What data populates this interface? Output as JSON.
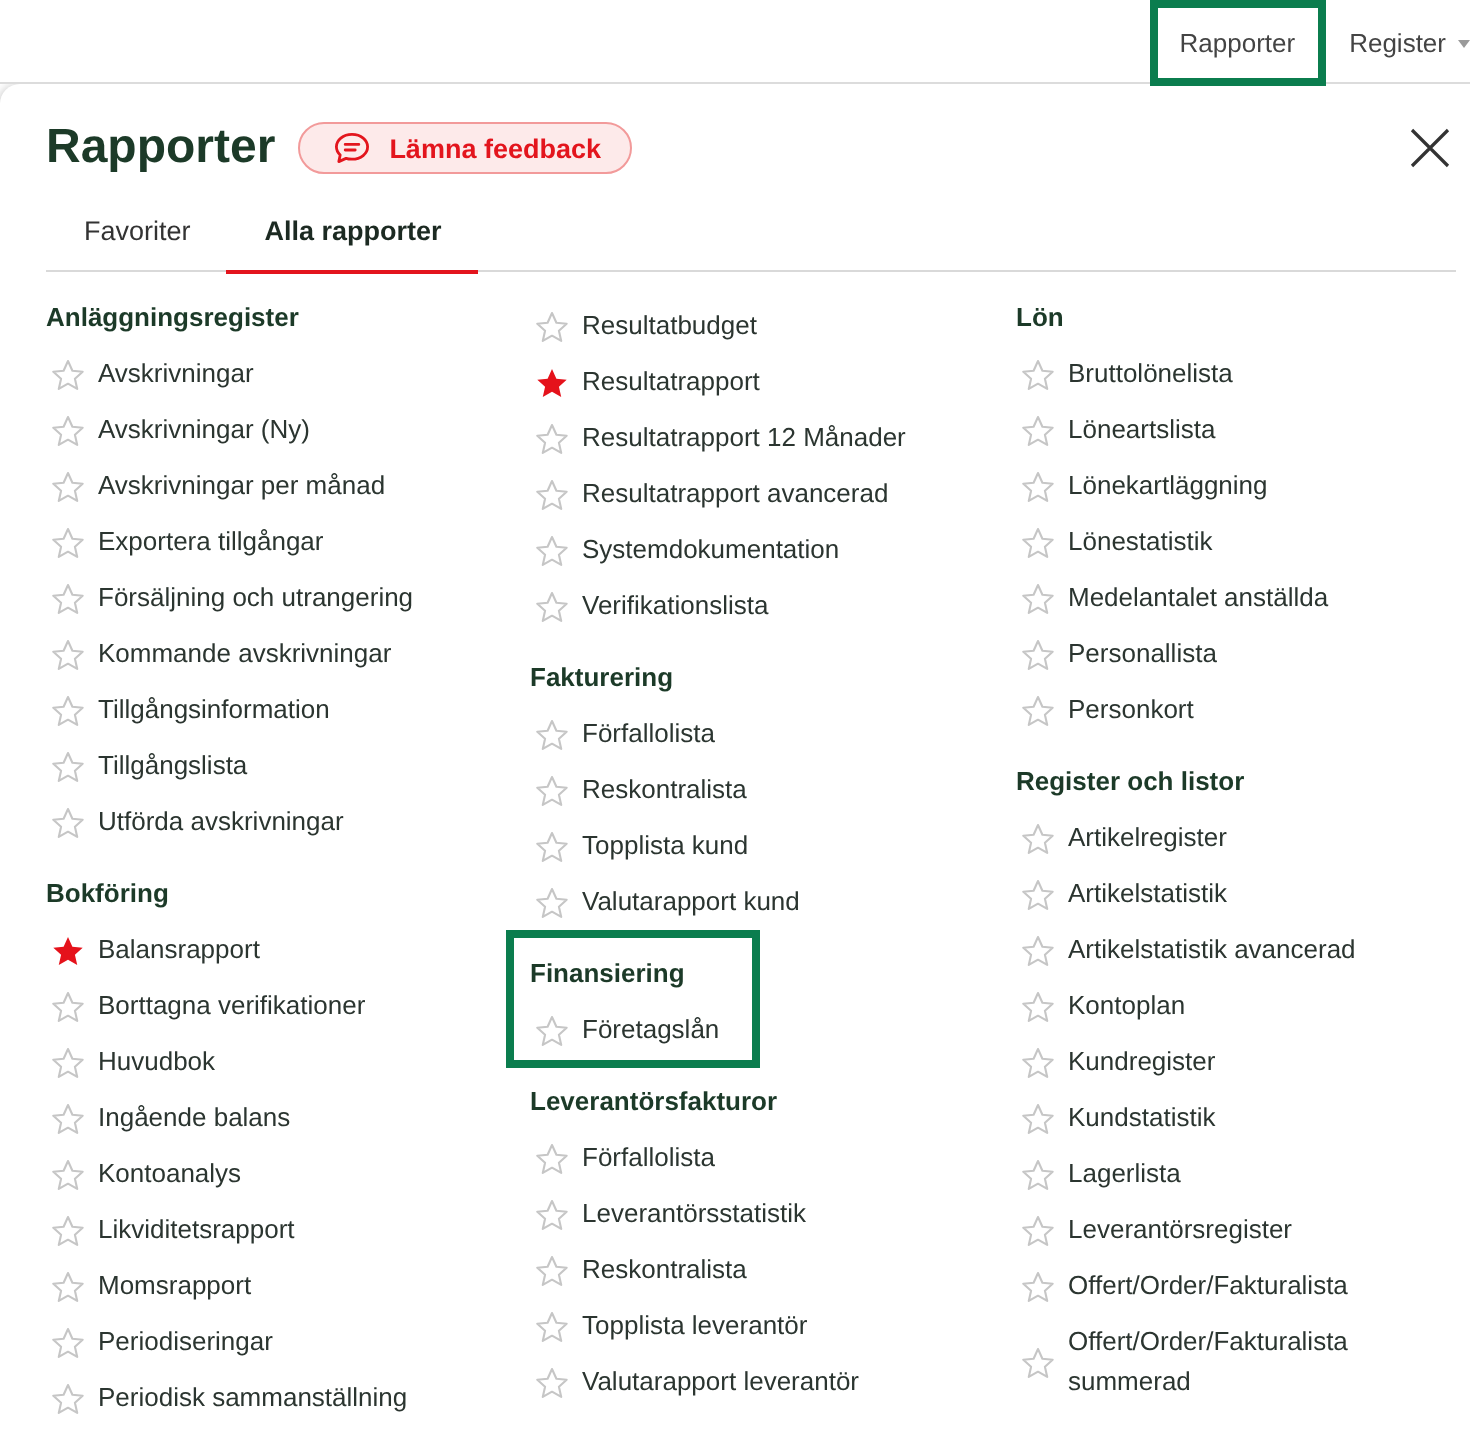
{
  "top_nav": [
    {
      "label": "Rapporter",
      "highlighted": true,
      "has_menu": false
    },
    {
      "label": "Register",
      "highlighted": false,
      "has_menu": true
    }
  ],
  "panel": {
    "title": "Rapporter",
    "feedback_button": "Lämna feedback"
  },
  "tabs": [
    {
      "label": "Favoriter",
      "selected": false
    },
    {
      "label": "Alla rapporter",
      "selected": true
    }
  ],
  "columns": [
    {
      "sections": [
        {
          "heading": "Anläggningsregister",
          "highlighted": false,
          "items": [
            {
              "label": "Avskrivningar",
              "favorite": false
            },
            {
              "label": "Avskrivningar (Ny)",
              "favorite": false
            },
            {
              "label": "Avskrivningar per månad",
              "favorite": false
            },
            {
              "label": "Exportera tillgångar",
              "favorite": false
            },
            {
              "label": "Försäljning och utrangering",
              "favorite": false
            },
            {
              "label": "Kommande avskrivningar",
              "favorite": false
            },
            {
              "label": "Tillgångsinformation",
              "favorite": false
            },
            {
              "label": "Tillgångslista",
              "favorite": false
            },
            {
              "label": "Utförda avskrivningar",
              "favorite": false
            }
          ]
        },
        {
          "heading": "Bokföring",
          "highlighted": false,
          "items": [
            {
              "label": "Balansrapport",
              "favorite": true
            },
            {
              "label": "Borttagna verifikationer",
              "favorite": false
            },
            {
              "label": "Huvudbok",
              "favorite": false
            },
            {
              "label": "Ingående balans",
              "favorite": false
            },
            {
              "label": "Kontoanalys",
              "favorite": false
            },
            {
              "label": "Likviditetsrapport",
              "favorite": false
            },
            {
              "label": "Momsrapport",
              "favorite": false
            },
            {
              "label": "Periodiseringar",
              "favorite": false
            },
            {
              "label": "Periodisk sammanställning",
              "favorite": false
            }
          ]
        }
      ]
    },
    {
      "sections": [
        {
          "highlighted": false,
          "items": [
            {
              "label": "Resultatbudget",
              "favorite": false
            },
            {
              "label": "Resultatrapport",
              "favorite": true
            },
            {
              "label": "Resultatrapport 12 Månader",
              "favorite": false
            },
            {
              "label": "Resultatrapport avancerad",
              "favorite": false
            },
            {
              "label": "Systemdokumentation",
              "favorite": false
            },
            {
              "label": "Verifikationslista",
              "favorite": false
            }
          ]
        },
        {
          "heading": "Fakturering",
          "highlighted": false,
          "items": [
            {
              "label": "Förfallolista",
              "favorite": false
            },
            {
              "label": "Reskontralista",
              "favorite": false
            },
            {
              "label": "Topplista kund",
              "favorite": false
            },
            {
              "label": "Valutarapport kund",
              "favorite": false
            }
          ]
        },
        {
          "heading": "Finansiering",
          "highlighted": true,
          "items": [
            {
              "label": "Företagslån",
              "favorite": false
            }
          ]
        },
        {
          "heading": "Leverantörsfakturor",
          "highlighted": false,
          "items": [
            {
              "label": "Förfallolista",
              "favorite": false
            },
            {
              "label": "Leverantörsstatistik",
              "favorite": false
            },
            {
              "label": "Reskontralista",
              "favorite": false
            },
            {
              "label": "Topplista leverantör",
              "favorite": false
            },
            {
              "label": "Valutarapport leverantör",
              "favorite": false
            }
          ]
        }
      ]
    },
    {
      "sections": [
        {
          "heading": "Lön",
          "highlighted": false,
          "items": [
            {
              "label": "Bruttolönelista",
              "favorite": false
            },
            {
              "label": "Löneartslista",
              "favorite": false
            },
            {
              "label": "Lönekartläggning",
              "favorite": false
            },
            {
              "label": "Lönestatistik",
              "favorite": false
            },
            {
              "label": "Medelantalet anställda",
              "favorite": false
            },
            {
              "label": "Personallista",
              "favorite": false
            },
            {
              "label": "Personkort",
              "favorite": false
            }
          ]
        },
        {
          "heading": "Register och listor",
          "highlighted": false,
          "items": [
            {
              "label": "Artikelregister",
              "favorite": false
            },
            {
              "label": "Artikelstatistik",
              "favorite": false
            },
            {
              "label": "Artikelstatistik avancerad",
              "favorite": false
            },
            {
              "label": "Kontoplan",
              "favorite": false
            },
            {
              "label": "Kundregister",
              "favorite": false
            },
            {
              "label": "Kundstatistik",
              "favorite": false
            },
            {
              "label": "Lagerlista",
              "favorite": false
            },
            {
              "label": "Leverantörsregister",
              "favorite": false
            },
            {
              "label": "Offert/Order/Fakturalista",
              "favorite": false
            },
            {
              "label": "Offert/Order/Fakturalista summerad",
              "favorite": false
            }
          ]
        }
      ]
    }
  ]
}
